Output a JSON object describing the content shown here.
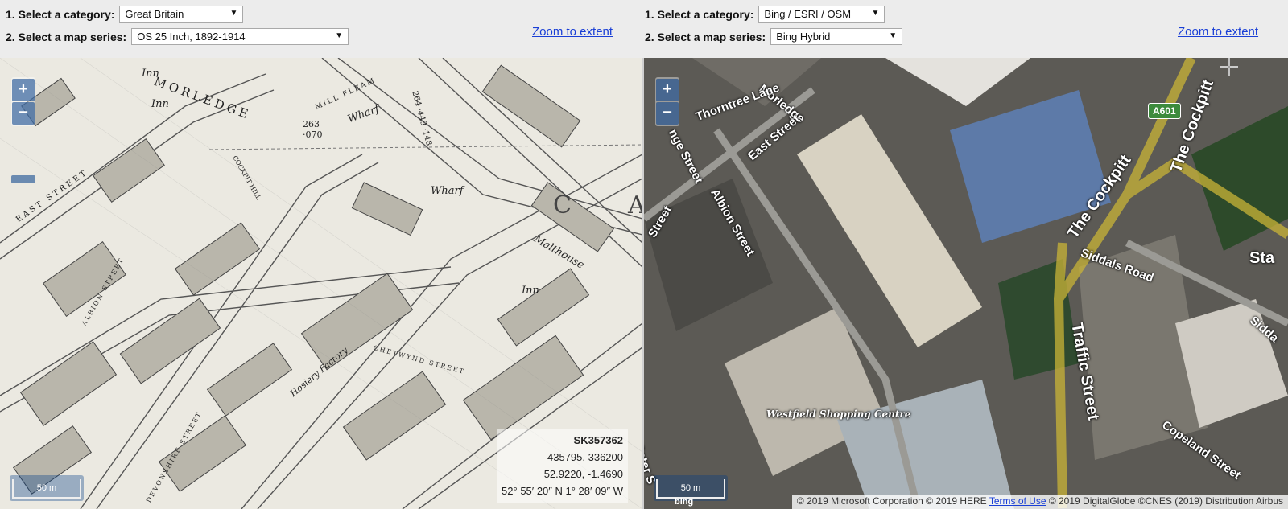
{
  "left": {
    "category_label": "1. Select a category:",
    "category_value": "Great Britain",
    "series_label": "2. Select a map series:",
    "series_value": "OS 25 Inch, 1892-1914",
    "zoom_extent": "Zoom to extent",
    "zoom_in": "+",
    "zoom_out": "−",
    "scale": "50 m",
    "coords": {
      "grid_ref": "SK357362",
      "easting_northing": "435795, 336200",
      "latlon_decimal": "52.9220, -1.4690",
      "latlon_dms": "52° 55′ 20″ N 1° 28′ 09″ W"
    },
    "map_labels": [
      "MORLEDGE",
      "Inn",
      "Wharf",
      "Wharf",
      "Malthouse",
      "MILL FLEAM",
      "EAST STREET",
      "COCKPIT HILL",
      "CHETWYND STREET",
      "Hosiery Factory",
      "DEVONSHIRE STREET",
      "ALBION STREET",
      "Inn",
      "Inn",
      "263 ·070",
      "264 ·449 ·148",
      "C",
      "A"
    ]
  },
  "right": {
    "category_label": "1. Select a category:",
    "category_value": "Bing / ESRI / OSM",
    "series_label": "2. Select a map series:",
    "series_value": "Bing Hybrid",
    "zoom_extent": "Zoom to extent",
    "zoom_in": "+",
    "zoom_out": "−",
    "scale": "50 m",
    "bing_logo": "bing",
    "attribution_pre": "© 2019 Microsoft Corporation © 2019 HERE ",
    "attribution_link": "Terms of Use",
    "attribution_post": " © 2019 DigitalGlobe ©CNES (2019) Distribution Airbus",
    "road_shield": "A601",
    "map_labels": [
      "Morledge",
      "Thorntree Lane",
      "East Street",
      "Albion Street",
      "Street",
      "nge Street",
      "The Cockpitt",
      "The Cockpitt",
      "Siddals Road",
      "Traffic Street",
      "Westfield Shopping Centre",
      "Copeland Street",
      "Sidda",
      "Sta",
      "Peter S"
    ]
  }
}
